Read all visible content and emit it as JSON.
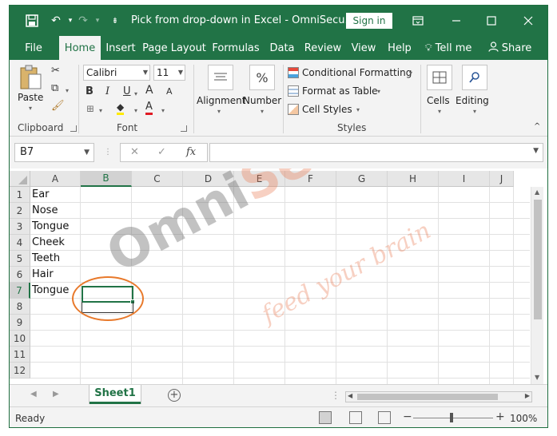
{
  "titlebar": {
    "title": "Pick from drop-down in Excel - OmniSecu.co...",
    "signin_label": "Sign in",
    "save_icon": "save-icon",
    "undo_icon": "undo-icon",
    "redo_icon": "redo-icon"
  },
  "tabs": [
    "File",
    "Home",
    "Insert",
    "Page Layout",
    "Formulas",
    "Data",
    "Review",
    "View",
    "Help",
    "Tell me",
    "Share"
  ],
  "ribbon": {
    "clipboard": {
      "paste_label": "Paste",
      "group_label": "Clipboard"
    },
    "font": {
      "font_name": "Calibri",
      "font_size": "11",
      "bold": "B",
      "italic": "I",
      "underline": "U",
      "grow": "A",
      "shrink": "A",
      "group_label": "Font"
    },
    "alignment": {
      "label": "Alignment"
    },
    "number": {
      "label": "Number",
      "icon_text": "%"
    },
    "styles": {
      "conditional_formatting": "Conditional Formatting",
      "format_as_table": "Format as Table",
      "cell_styles": "Cell Styles",
      "group_label": "Styles"
    },
    "cells": {
      "label": "Cells"
    },
    "editing": {
      "label": "Editing"
    }
  },
  "formula_bar": {
    "name_box": "B7",
    "cancel": "✕",
    "enter": "✓",
    "fx": "fx",
    "formula": ""
  },
  "grid": {
    "columns": [
      "A",
      "B",
      "C",
      "D",
      "E",
      "F",
      "G",
      "H",
      "I",
      "J"
    ],
    "rows": [
      "1",
      "2",
      "3",
      "4",
      "5",
      "6",
      "7",
      "8",
      "9",
      "10",
      "11",
      "12"
    ],
    "cells_a": [
      "Ear",
      "Nose",
      "Tongue",
      "Cheek",
      "Teeth",
      "Hair",
      "Tongue"
    ],
    "selected_column": "B",
    "selected_row": "7"
  },
  "watermark": {
    "omni": "Omni",
    "secu": "Secu.com",
    "tagline": "feed your brain"
  },
  "sheets": {
    "active": "Sheet1"
  },
  "status": {
    "ready": "Ready",
    "zoom": "100%"
  },
  "colors": {
    "accent": "#217346",
    "callout": "#e8792b"
  }
}
